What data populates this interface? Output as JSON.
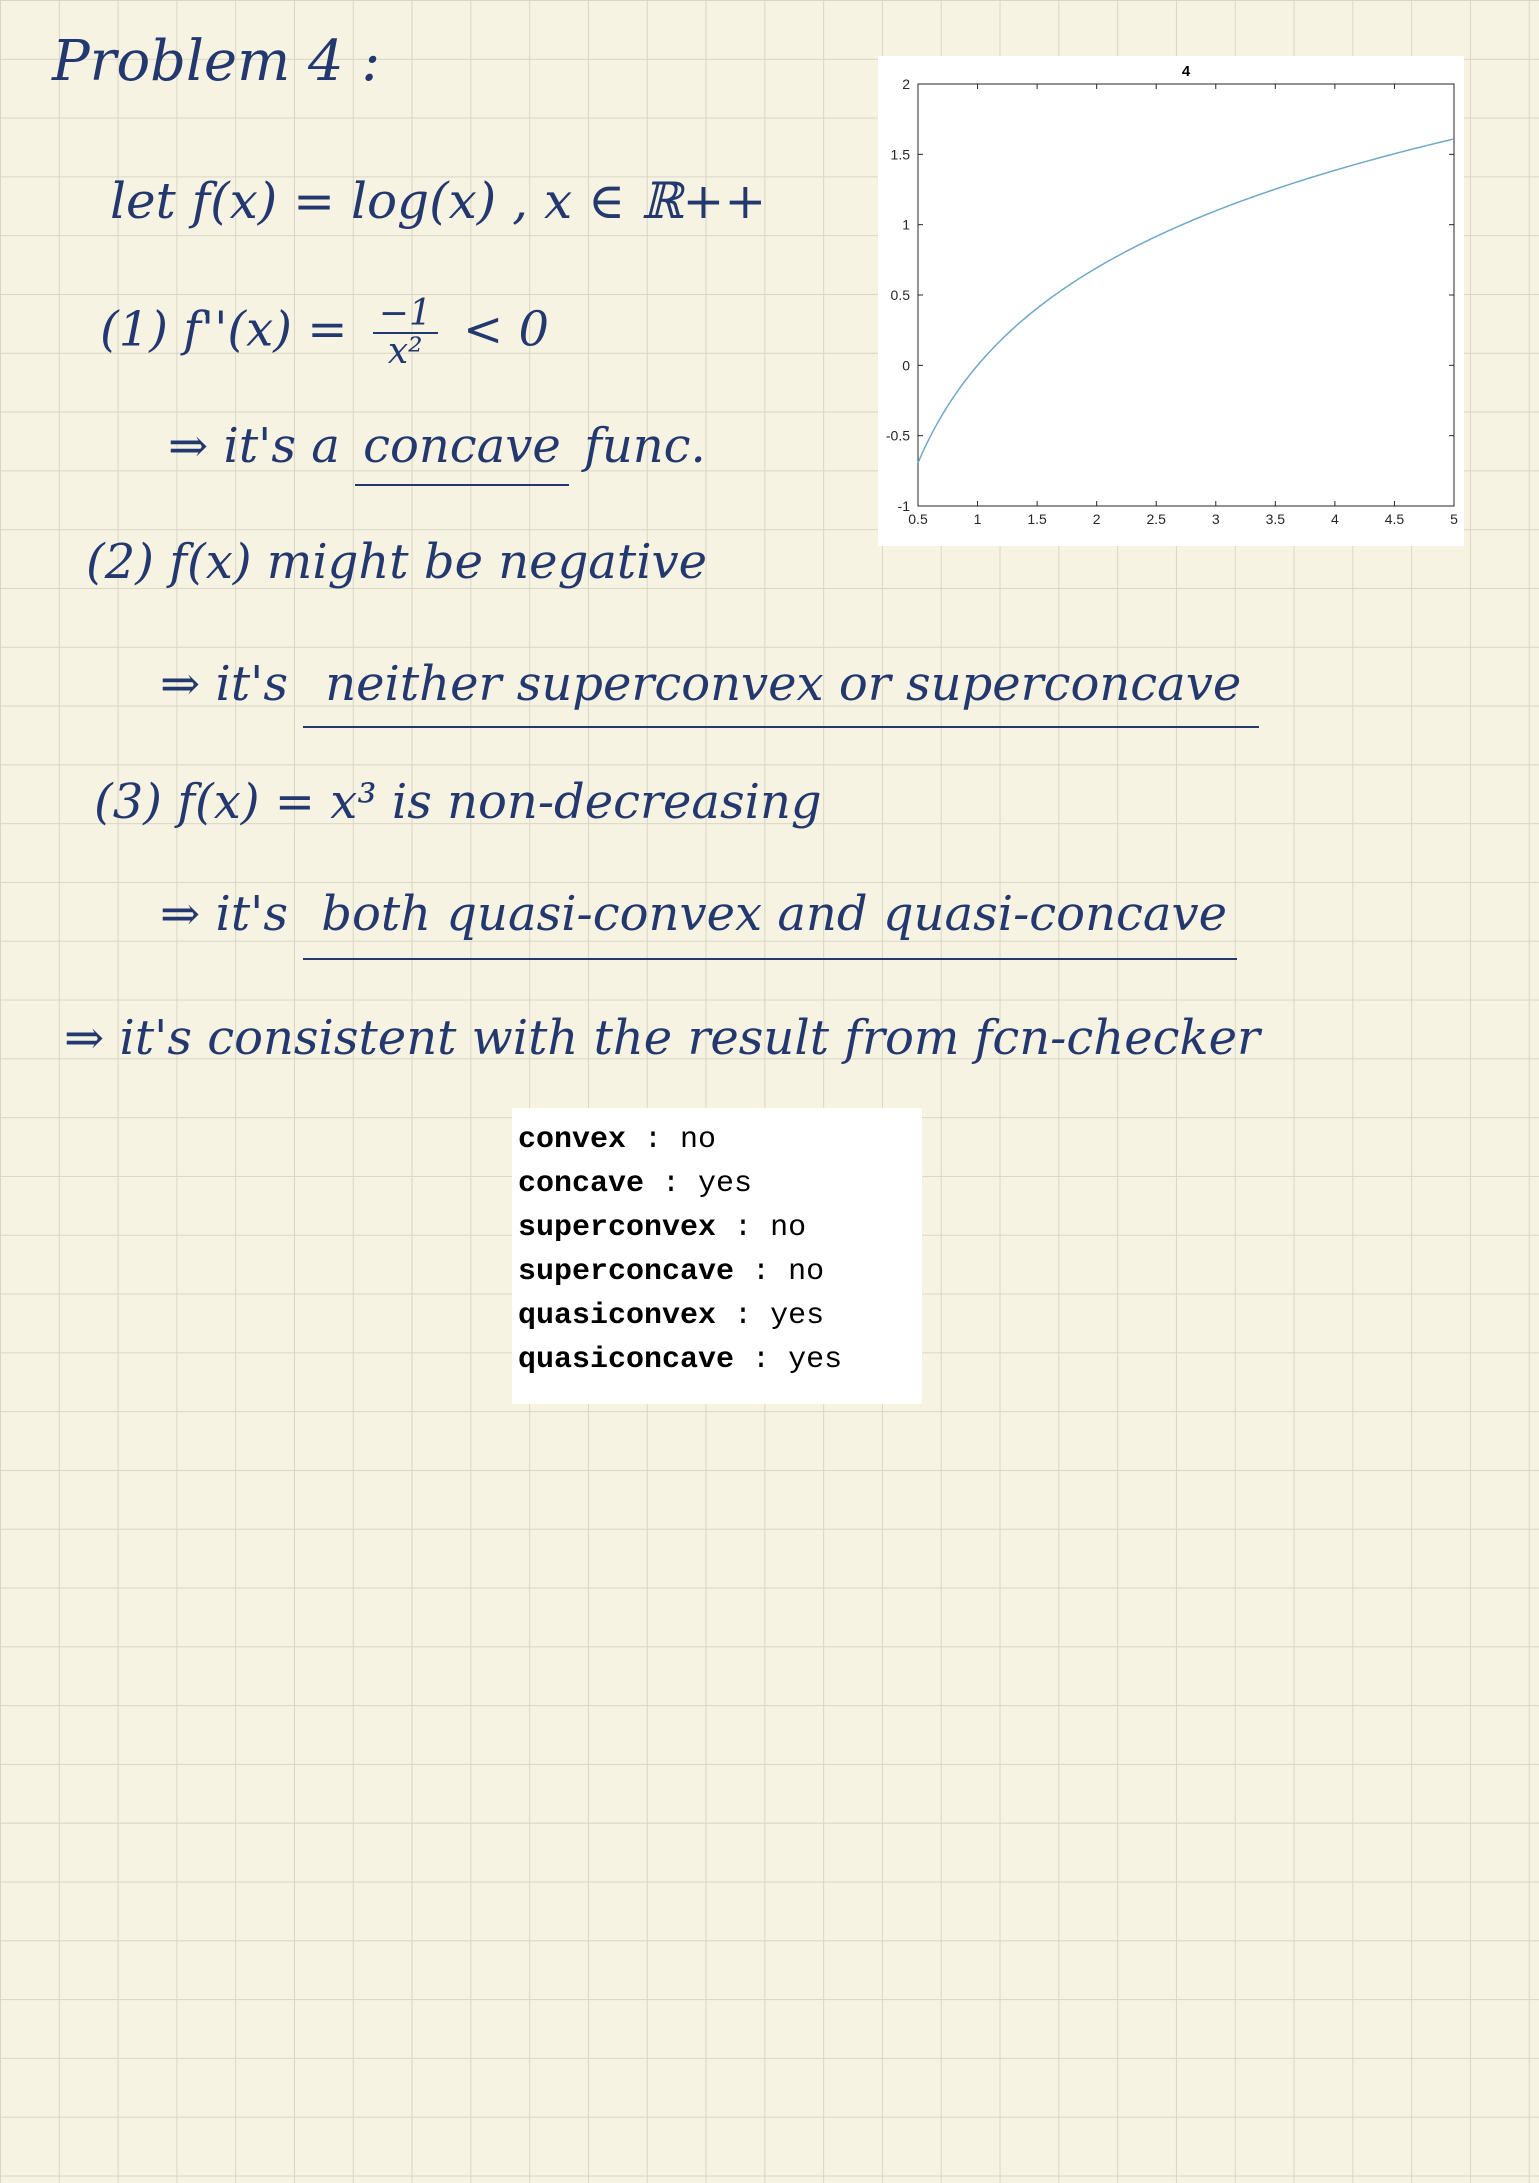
{
  "notes": {
    "title": "Problem 4 :",
    "line1": "let f(x) = log(x) , x ∈ ℝ++",
    "line2_num": "(1)",
    "line2_expr": "f''(x) =",
    "line2_num_frac": "−1",
    "line2_den_frac": "x²",
    "line2_ineq": "< 0",
    "line3_pre": "⇒ it's a",
    "line3_ul": "concave",
    "line3_post": "func.",
    "line4": "(2) f(x) might be negative",
    "line5_pre": "⇒ it's",
    "line5_ul": "neither superconvex or superconcave",
    "line6": "(3) f(x) = x³ is non-decreasing",
    "line7_pre": "⇒ it's",
    "line7_ul": "both   quasi-convex and quasi-concave",
    "line8": "⇒ it's consistent with the result from fcn-checker"
  },
  "chart_data": {
    "type": "line",
    "title": "4",
    "xlim": [
      0.5,
      5
    ],
    "ylim": [
      -1,
      2
    ],
    "xticks": [
      "0.5",
      "1",
      "1.5",
      "2",
      "2.5",
      "3",
      "3.5",
      "4",
      "4.5",
      "5"
    ],
    "yticks": [
      "-1",
      "-0.5",
      "0",
      "0.5",
      "1",
      "1.5",
      "2"
    ],
    "function": "log(x)",
    "x": [
      0.5,
      0.75,
      1.0,
      1.25,
      1.5,
      1.75,
      2.0,
      2.25,
      2.5,
      2.75,
      3.0,
      3.25,
      3.5,
      3.75,
      4.0,
      4.25,
      4.5,
      4.75,
      5.0
    ],
    "series": [
      {
        "values": [
          -0.693,
          -0.288,
          0.0,
          0.223,
          0.405,
          0.56,
          0.693,
          0.811,
          0.916,
          1.012,
          1.099,
          1.179,
          1.253,
          1.322,
          1.386,
          1.447,
          1.504,
          1.558,
          1.609
        ],
        "color": "#6fa8c9"
      }
    ],
    "grid": false
  },
  "checker": [
    {
      "key": "convex",
      "sep": " : ",
      "value": "no"
    },
    {
      "key": "concave",
      "sep": " : ",
      "value": "yes"
    },
    {
      "key": "superconvex",
      "sep": " : ",
      "value": "no"
    },
    {
      "key": "superconcave",
      "sep": " : ",
      "value": "no"
    },
    {
      "key": "quasiconvex",
      "sep": " : ",
      "value": "yes"
    },
    {
      "key": "quasiconcave",
      "sep": " : ",
      "value": "yes"
    }
  ],
  "colors": {
    "ink": "#23386f",
    "paper": "#f7f3e3",
    "grid": "#d9d6c6"
  }
}
